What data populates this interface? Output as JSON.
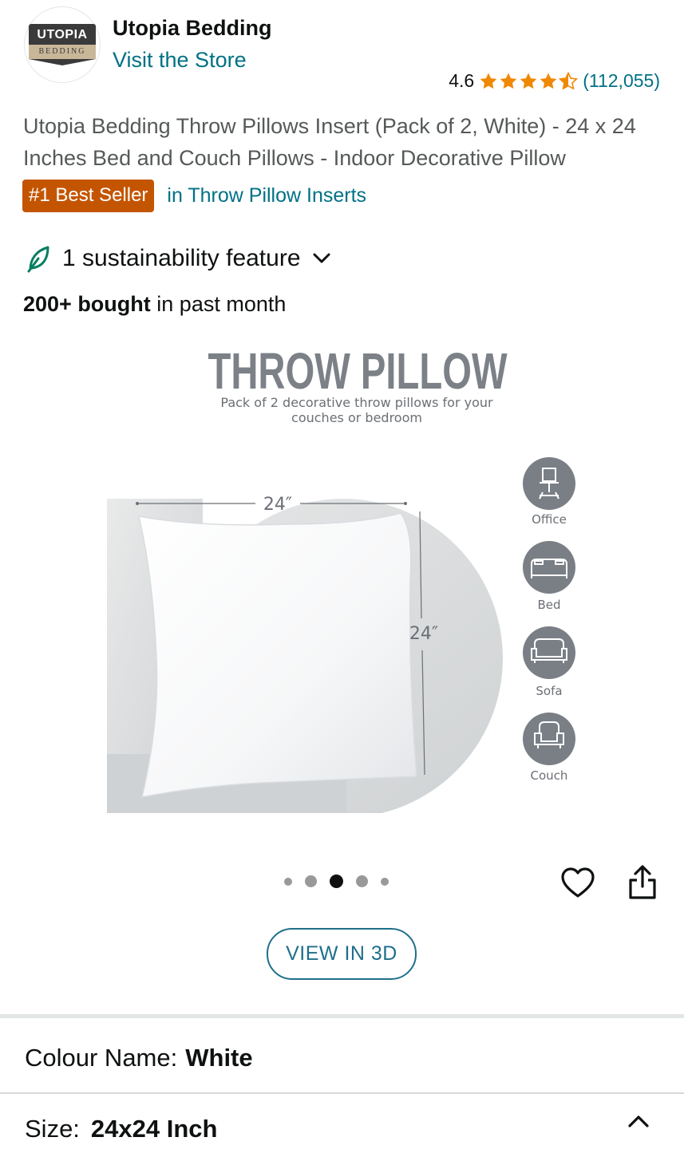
{
  "store": {
    "logo_top": "UTOPIA",
    "logo_bottom": "BEDDING",
    "name": "Utopia Bedding",
    "link": "Visit the Store"
  },
  "rating": {
    "value": "4.6",
    "stars": 4.5,
    "count": "(112,055)",
    "star_color": "#f08804"
  },
  "product": {
    "title": "Utopia Bedding Throw Pillows Insert (Pack of 2, White) - 24 x 24 Inches Bed and Couch Pillows - Indoor Decorative Pillow",
    "badge": "#1 Best Seller",
    "badge_category": "in Throw Pillow Inserts",
    "sustainability": "1 sustainability feature",
    "bought_bold": "200+ bought",
    "bought_rest": " in past month"
  },
  "image": {
    "headline": "THROW PILLOW",
    "subtext_line1": "Pack of 2 decorative throw pillows for your",
    "subtext_line2": "couches or bedroom",
    "width_label": "24″",
    "height_label": "24″",
    "uses": [
      "Office",
      "Bed",
      "Sofa",
      "Couch"
    ]
  },
  "carousel": {
    "count": 5,
    "active_index": 2
  },
  "actions": {
    "view3d": "VIEW IN 3D"
  },
  "variations": {
    "colour_label": "Colour Name:",
    "colour_value": "White",
    "size_label": "Size:",
    "size_value": "24x24 Inch"
  }
}
